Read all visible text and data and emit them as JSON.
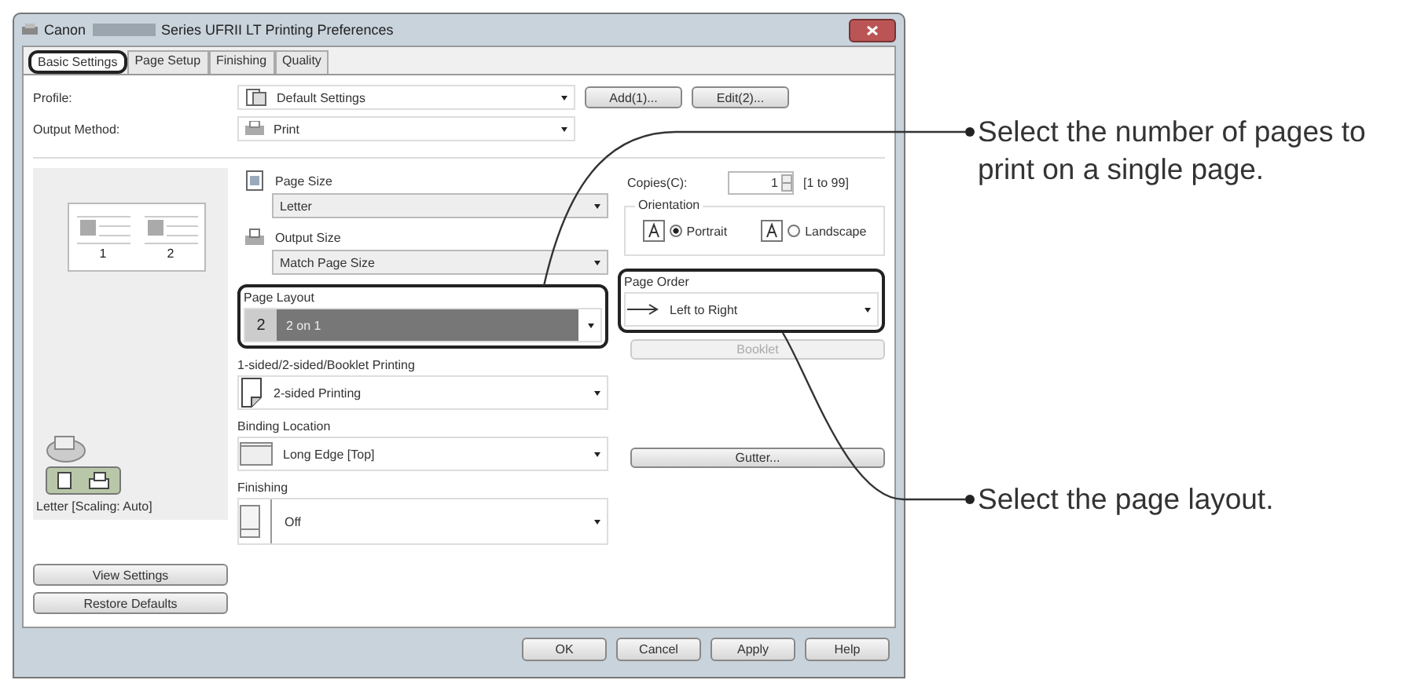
{
  "window": {
    "title_prefix": "Canon",
    "title_suffix": "Series UFRII LT Printing Preferences"
  },
  "tabs": [
    {
      "label": "Basic Settings",
      "selected": true
    },
    {
      "label": "Page Setup",
      "selected": false
    },
    {
      "label": "Finishing",
      "selected": false
    },
    {
      "label": "Quality",
      "selected": false
    }
  ],
  "profile": {
    "label": "Profile:",
    "value": "Default Settings",
    "buttons": [
      "Add(1)...",
      "Edit(2)..."
    ]
  },
  "output_method": {
    "label": "Output Method:",
    "value": "Print"
  },
  "preview": {
    "page_numbers": [
      "1",
      "2"
    ],
    "caption": "Letter [Scaling: Auto]",
    "buttons": [
      "View Settings",
      "Restore Defaults"
    ]
  },
  "page_size": {
    "label": "Page Size",
    "value": "Letter"
  },
  "output_size": {
    "label": "Output Size",
    "value": "Match Page Size"
  },
  "page_layout": {
    "label": "Page Layout",
    "number": "2",
    "value": "2 on 1",
    "highlighted": true
  },
  "duplex": {
    "label": "1-sided/2-sided/Booklet Printing",
    "value": "2-sided Printing"
  },
  "binding_location": {
    "label": "Binding Location",
    "value": "Long Edge [Top]"
  },
  "finishing": {
    "label": "Finishing",
    "value": "Off"
  },
  "copies": {
    "label": "Copies(C):",
    "value": "1",
    "range": "[1 to 99]"
  },
  "orientation": {
    "label": "Orientation",
    "options": [
      {
        "label": "Portrait",
        "selected": true
      },
      {
        "label": "Landscape",
        "selected": false
      }
    ]
  },
  "page_order": {
    "label": "Page Order",
    "value": "Left to Right"
  },
  "booklet_button": {
    "label": "Booklet",
    "disabled": true
  },
  "gutter_button": {
    "label": "Gutter..."
  },
  "dialog_buttons": [
    "OK",
    "Cancel",
    "Apply",
    "Help"
  ],
  "callouts": [
    {
      "text": "Select the number of pages to print on a single page."
    },
    {
      "text": "Select the page layout."
    }
  ]
}
